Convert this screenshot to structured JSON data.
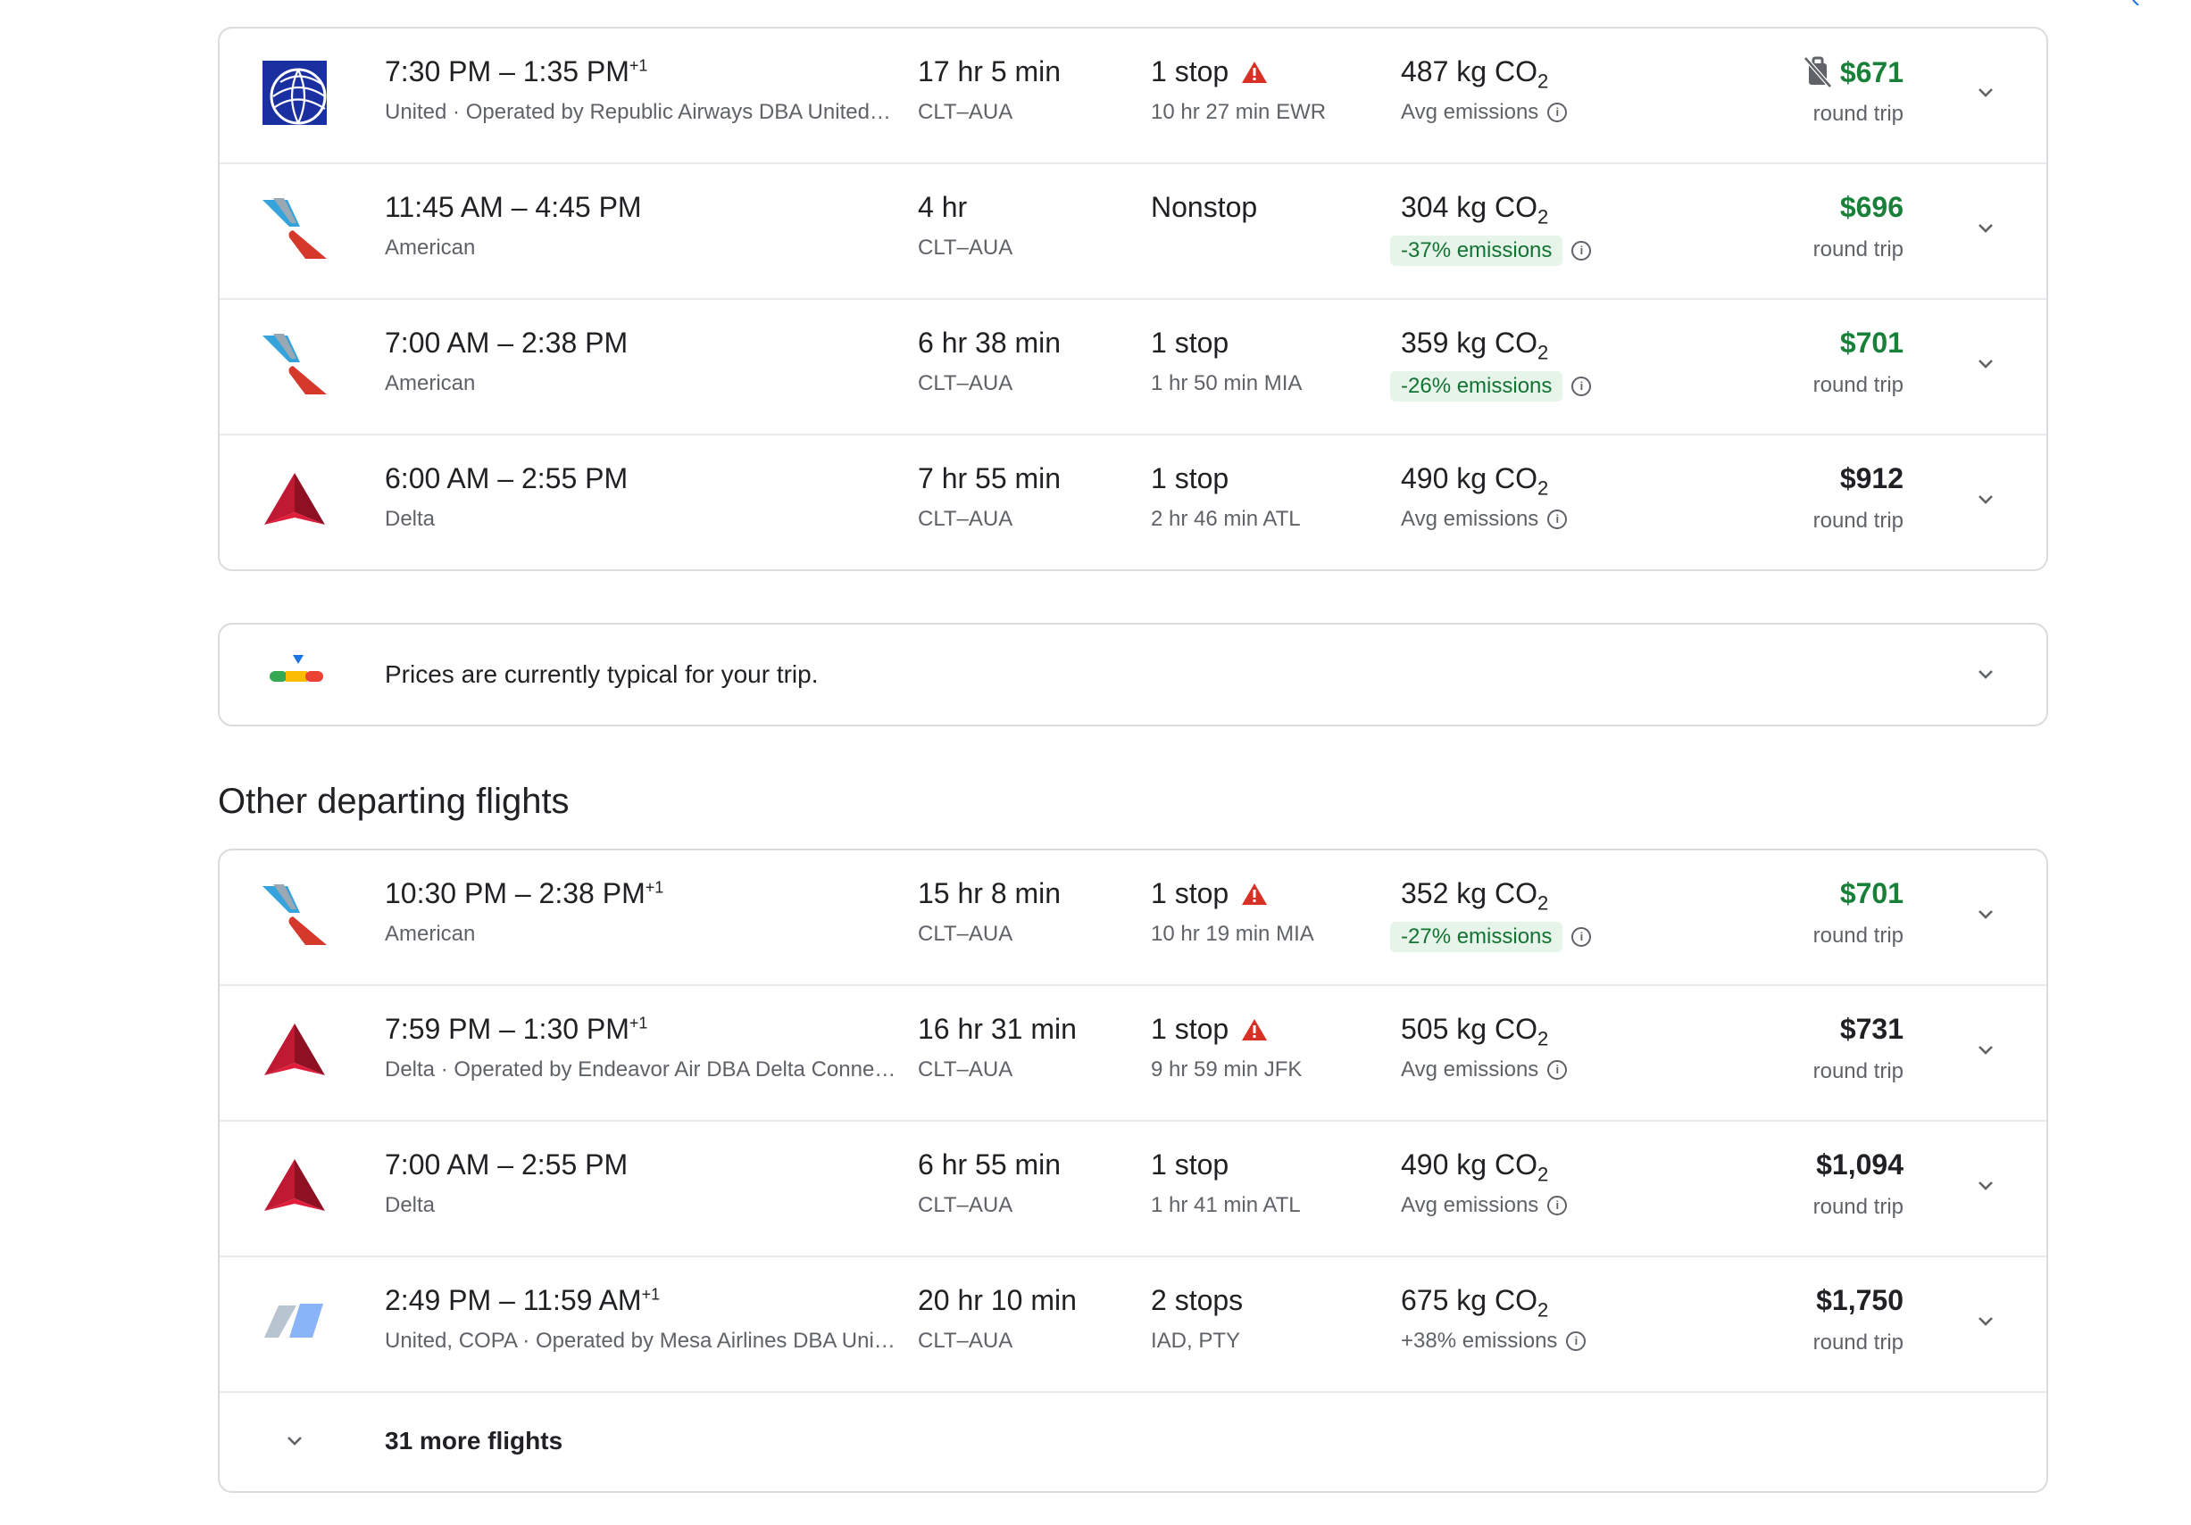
{
  "top_flights": [
    {
      "times": "7:30 PM – 1:35 PM",
      "day_offset": "+1",
      "airline": "United · Operated by Republic Airways DBA United…",
      "duration": "17 hr 5 min",
      "route": "CLT–AUA",
      "stops": "1 stop",
      "warning": true,
      "layover": "10 hr 27 min EWR",
      "co2": "487 kg CO",
      "co2_sub": "2",
      "emissions": "Avg emissions",
      "emissions_badge": false,
      "price": "$671",
      "price_green": true,
      "no_bag_icon": true,
      "price_sub": "round trip",
      "logo": "united-globe"
    },
    {
      "times": "11:45 AM – 4:45 PM",
      "day_offset": "",
      "airline": "American",
      "duration": "4 hr",
      "route": "CLT–AUA",
      "stops": "Nonstop",
      "warning": false,
      "layover": "",
      "co2": "304 kg CO",
      "co2_sub": "2",
      "emissions": "-37% emissions",
      "emissions_badge": true,
      "price": "$696",
      "price_green": true,
      "no_bag_icon": false,
      "price_sub": "round trip",
      "logo": "american-tail"
    },
    {
      "times": "7:00 AM – 2:38 PM",
      "day_offset": "",
      "airline": "American",
      "duration": "6 hr 38 min",
      "route": "CLT–AUA",
      "stops": "1 stop",
      "warning": false,
      "layover": "1 hr 50 min MIA",
      "co2": "359 kg CO",
      "co2_sub": "2",
      "emissions": "-26% emissions",
      "emissions_badge": true,
      "price": "$701",
      "price_green": true,
      "no_bag_icon": false,
      "price_sub": "round trip",
      "logo": "american-tail"
    },
    {
      "times": "6:00 AM – 2:55 PM",
      "day_offset": "",
      "airline": "Delta",
      "duration": "7 hr 55 min",
      "route": "CLT–AUA",
      "stops": "1 stop",
      "warning": false,
      "layover": "2 hr 46 min ATL",
      "co2": "490 kg CO",
      "co2_sub": "2",
      "emissions": "Avg emissions",
      "emissions_badge": false,
      "price": "$912",
      "price_green": false,
      "no_bag_icon": false,
      "price_sub": "round trip",
      "logo": "delta-widget"
    }
  ],
  "insight": {
    "text": "Prices are currently typical for your trip."
  },
  "other_title": "Other departing flights",
  "other_flights": [
    {
      "times": "10:30 PM – 2:38 PM",
      "day_offset": "+1",
      "airline": "American",
      "duration": "15 hr 8 min",
      "route": "CLT–AUA",
      "stops": "1 stop",
      "warning": true,
      "layover": "10 hr 19 min MIA",
      "co2": "352 kg CO",
      "co2_sub": "2",
      "emissions": "-27% emissions",
      "emissions_badge": true,
      "price": "$701",
      "price_green": true,
      "no_bag_icon": false,
      "price_sub": "round trip",
      "logo": "american-tail"
    },
    {
      "times": "7:59 PM – 1:30 PM",
      "day_offset": "+1",
      "airline": "Delta · Operated by Endeavor Air DBA Delta Conne…",
      "duration": "16 hr 31 min",
      "route": "CLT–AUA",
      "stops": "1 stop",
      "warning": true,
      "layover": "9 hr 59 min JFK",
      "co2": "505 kg CO",
      "co2_sub": "2",
      "emissions": "Avg emissions",
      "emissions_badge": false,
      "price": "$731",
      "price_green": false,
      "no_bag_icon": false,
      "price_sub": "round trip",
      "logo": "delta-widget"
    },
    {
      "times": "7:00 AM – 2:55 PM",
      "day_offset": "",
      "airline": "Delta",
      "duration": "6 hr 55 min",
      "route": "CLT–AUA",
      "stops": "1 stop",
      "warning": false,
      "layover": "1 hr 41 min ATL",
      "co2": "490 kg CO",
      "co2_sub": "2",
      "emissions": "Avg emissions",
      "emissions_badge": false,
      "price": "$1,094",
      "price_green": false,
      "no_bag_icon": false,
      "price_sub": "round trip",
      "logo": "delta-widget"
    },
    {
      "times": "2:49 PM – 11:59 AM",
      "day_offset": "+1",
      "airline": "United, COPA · Operated by Mesa Airlines DBA Uni…",
      "duration": "20 hr 10 min",
      "route": "CLT–AUA",
      "stops": "2 stops",
      "warning": false,
      "layover": "IAD, PTY",
      "co2": "675 kg CO",
      "co2_sub": "2",
      "emissions": "+38% emissions",
      "emissions_badge": false,
      "price": "$1,750",
      "price_green": false,
      "no_bag_icon": false,
      "price_sub": "round trip",
      "logo": "multi-carrier-tail"
    }
  ],
  "more": {
    "label": "31 more flights"
  },
  "colors": {
    "green": "#188038",
    "badge_bg": "#e6f4ea",
    "warning": "#d93025",
    "border": "#dadce0"
  }
}
